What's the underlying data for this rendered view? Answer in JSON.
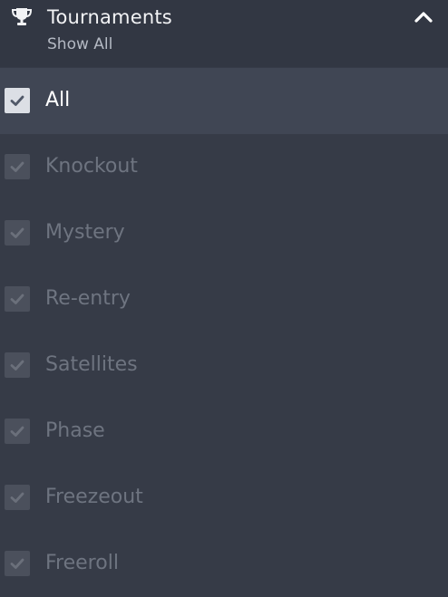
{
  "header": {
    "icon": "trophy-icon",
    "title": "Tournaments",
    "subtitle": "Show All",
    "collapse_icon": "chevron-up-icon"
  },
  "filters": [
    {
      "label": "All",
      "checked": true,
      "active": true
    },
    {
      "label": "Knockout",
      "checked": true,
      "active": false
    },
    {
      "label": "Mystery",
      "checked": true,
      "active": false
    },
    {
      "label": "Re-entry",
      "checked": true,
      "active": false
    },
    {
      "label": "Satellites",
      "checked": true,
      "active": false
    },
    {
      "label": "Phase",
      "checked": true,
      "active": false
    },
    {
      "label": "Freezeout",
      "checked": true,
      "active": false
    },
    {
      "label": "Freeroll",
      "checked": true,
      "active": false
    }
  ],
  "colors": {
    "panel_bg": "#363b47",
    "header_bg": "#323743",
    "active_row_bg": "#404654",
    "active_checkbox": "#dcdfe5",
    "inactive_checkbox": "#4b505c",
    "inactive_label": "#6e7480"
  }
}
